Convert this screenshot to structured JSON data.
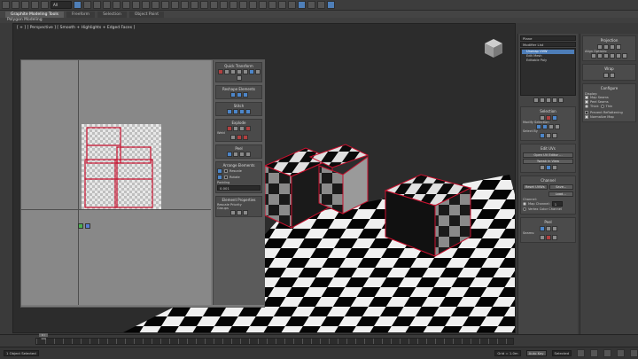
{
  "app": {
    "selector_text": "All"
  },
  "ribbon": {
    "tabs": [
      {
        "label": "Graphite Modeling Tools"
      },
      {
        "label": "Freeform"
      },
      {
        "label": "Selection"
      },
      {
        "label": "Object Paint"
      }
    ]
  },
  "subribbon": {
    "label": "Polygon Modeling"
  },
  "viewport": {
    "label": "[ + ] [ Perspective ] [ Smooth + Highlights + Edged Faces ]"
  },
  "uvw_editor": {
    "quick_transform": "Quick Transform",
    "reshape": "Reshape Elements",
    "stitch": "Stitch",
    "explode": "Explode",
    "weld": "Weld",
    "peel": "Peel",
    "arrange": "Arrange Elements",
    "rescale": "Rescale",
    "rotate": "Rotate",
    "padding": "Padding",
    "padding_value": "0.001",
    "element_props": "Element Properties",
    "rescale_priority": "Rescale Priority",
    "groups": "Groups"
  },
  "command_panel": {
    "object_name": "Plane",
    "modifier_list": "Modifier List",
    "stack": [
      {
        "label": "Unwrap UVW"
      },
      {
        "label": "Edit Mesh"
      },
      {
        "label": "Editable Poly"
      }
    ],
    "selection": "Selection",
    "modify_selection": "Modify Selection",
    "select_by": "Select By",
    "edit_uvs": "Edit UVs",
    "open_uv_editor": "Open UV Editor ...",
    "tweak_in_view": "Tweak In View",
    "channel": "Channel",
    "reset_uvws": "Reset UVWs",
    "save": "Save...",
    "load": "Load...",
    "channel_label": "Channel:",
    "map_channel": "Map Channel:",
    "map_channel_value": "1",
    "vertex_color_channel": "Vertex Color Channel",
    "peel": "Peel",
    "seams": "Seams:"
  },
  "right_panel": {
    "projection": "Projection",
    "align_options": "Align Options:",
    "wrap": "Wrap",
    "configure": "Configure",
    "display": "Display:",
    "map_seams": "Map Seams",
    "peel_seams": "Peel Seams",
    "thick": "Thick",
    "thin": "Thin",
    "prevent_reflattening": "Prevent Reflattening",
    "normalize_map": "Normalize Map"
  },
  "timeline": {
    "frame": "0 / 100"
  },
  "status": {
    "selected": "1 Object Selected",
    "grid": "Grid = 1.0m",
    "auto_key": "Auto Key",
    "selected_btn": "Selected"
  },
  "colors": {
    "accent": "#4d7db8",
    "seam": "#c8102e"
  }
}
